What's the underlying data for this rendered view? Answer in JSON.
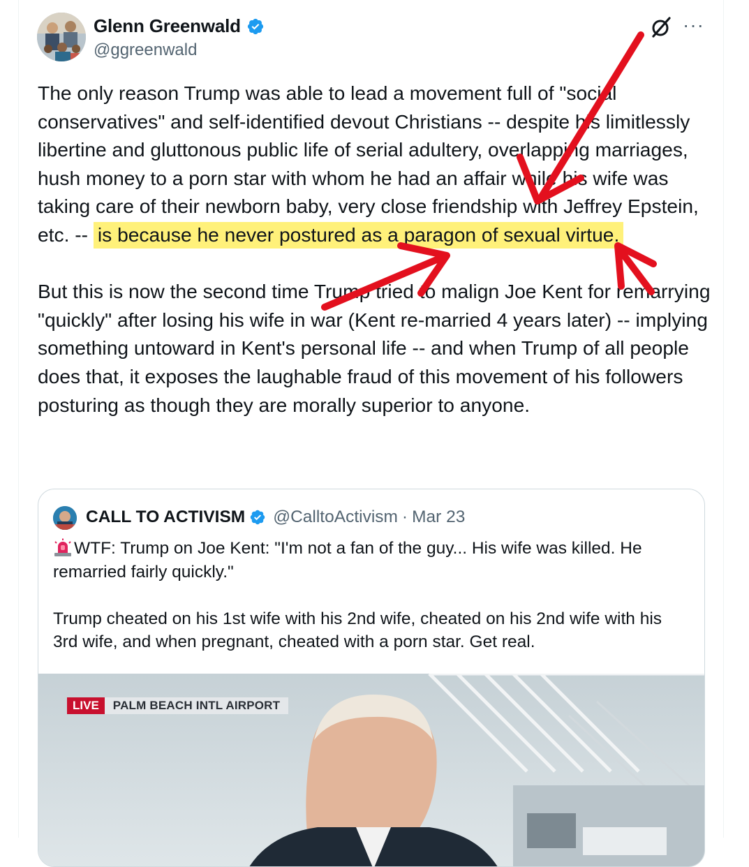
{
  "tweet": {
    "author_name": "Glenn Greenwald",
    "author_handle": "@ggreenwald",
    "verified_icon": "verified-badge-icon",
    "grok_icon": "grok-icon",
    "more_label": "···",
    "text_before_highlight": "The only reason Trump was able to lead a movement full of \"social conservatives\" and self-identified devout Christians -- despite his limitlessly libertine and gluttonous public life of serial adultery, overlapping marriages, hush money to a porn star with whom he had an affair while his wife was taking care of their newborn baby, very close friendship with Jeffrey Epstein, etc. -- ",
    "text_highlight": "is because he never postured as a paragon of sexual virtue.",
    "text_after_highlight": "\n\nBut this is now the second time Trump tried to malign Joe Kent for remarrying \"quickly\" after losing his wife in war (Kent re-married 4 years later) -- implying something untoward in Kent's personal life -- and when Trump of all people does that, it exposes the laughable fraud of this movement of his followers posturing as though they are morally superior to anyone.",
    "highlight_color": "#fff17a",
    "arrow_color": "#e3101e"
  },
  "quote": {
    "author_name": "CALL TO ACTIVISM",
    "author_handle": "@CalltoActivism",
    "separator": "·",
    "date": "Mar 23",
    "siren_icon": "rotating-light-icon",
    "text_line1": "WTF: Trump on Joe Kent: \"I'm not a fan of the guy... His wife was killed. He remarried fairly quickly.\"",
    "text_line2": "\n\nTrump cheated on his 1st wife with his 2nd wife, cheated on his 2nd wife with his 3rd wife, and when pregnant, cheated with a porn star. Get real.",
    "media": {
      "live_label": "LIVE",
      "location_label": "PALM BEACH INTL AIRPORT"
    }
  },
  "colors": {
    "text": "#0f1419",
    "secondary": "#536471",
    "verified_blue": "#1d9bf0",
    "border": "#cfd9de"
  }
}
